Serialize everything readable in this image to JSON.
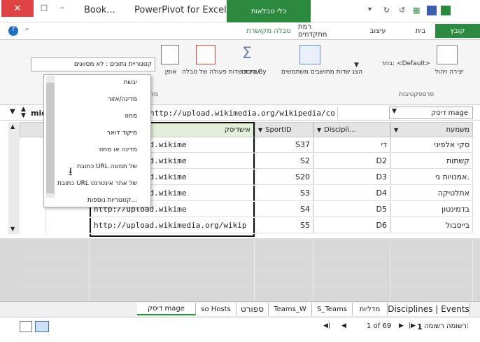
{
  "window": {
    "app_title": "PowerPivot for Excel",
    "book_title": "Book...",
    "context_tab_top": "כלי טבלאות",
    "close": "✕"
  },
  "tabs": {
    "file": "קובץ",
    "home": "בית",
    "design": "עיצוב",
    "advanced": "רמת מתקדמים",
    "table_tools": "טבלה מקושרת"
  },
  "ribbon": {
    "create_relationship": "יצירה\nויהול",
    "select_label": "בחר: <Default>",
    "perspectives_group": "פרספקטיבות",
    "show_hidden": "הצג שדות\nמחושבים משתמשים",
    "summary": "סיכום\nBy",
    "default_field": "ערכת שדות\nפעולה של טבלה",
    "table_behavior": "אופן",
    "data_category": "קטגוריית נתונים : לא מסווגים",
    "reporting_group": "מרווחים"
  },
  "formula_bar": {
    "table_name": "דיסק mage",
    "formula": "http://upload.wikimedia.org/wikipedia/co",
    "name_box": "mion"
  },
  "grid": {
    "headers": {
      "discipline_name": "משמעת",
      "discipline_id": "Discipli...",
      "sport_id": "SportID",
      "disc_image": "אישדיסק"
    },
    "rows": [
      {
        "name": "סקי אלפיני",
        "disc": "די",
        "sport": "S37",
        "url": "http://upload.wikime"
      },
      {
        "name": "קשתות",
        "disc": "D2",
        "sport": "S2",
        "url": "http://upload.wikime"
      },
      {
        "name": "אמנויות גי.",
        "disc": "D3",
        "sport": "S20",
        "url": "http://upload.wikime"
      },
      {
        "name": "אתלטיקה",
        "disc": "D4",
        "sport": "S3",
        "url": "http://upload.wikime"
      },
      {
        "name": "בדמינטון",
        "disc": "D5",
        "sport": "S4",
        "url": "http://upload.wikime"
      },
      {
        "name": "בייסבול",
        "disc": "D6",
        "sport": "S5",
        "url": "http://upload.wikimedia.org/wikip"
      }
    ]
  },
  "dropdown": {
    "items": [
      "יבשת",
      "מדינה/אזור",
      "מחוז",
      "מיקוד דואר",
      "מדינה או מחוז",
      "כתובת URL של תמונה",
      "כתובת URL של אתר אינטרנט",
      "קטגוריות נוספות..."
    ]
  },
  "sheet_tabs": {
    "disciplines": "Disciplines | Events",
    "medals": "מדליות",
    "s_teams": "S_Teams",
    "teams_w": "Teams_W",
    "sport": "ספורט",
    "hosts": "so Hosts",
    "disc_image": "דיסק mage"
  },
  "status": {
    "record_label": "רשומה רשומה:",
    "record_num": "1",
    "record_of": "1 of 69"
  }
}
